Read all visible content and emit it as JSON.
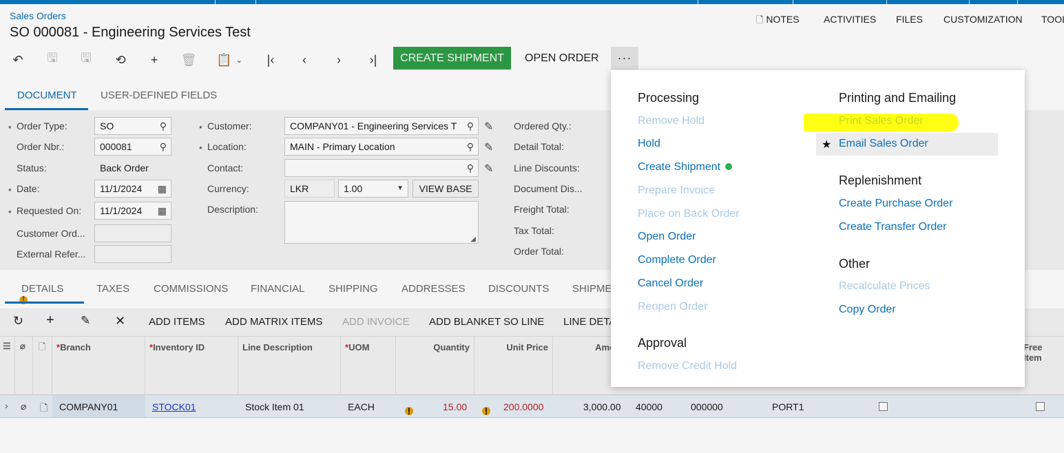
{
  "breadcrumb": "Sales Orders",
  "title": "SO 000081 - Engineering Services Test",
  "top_nav": [
    "NOTES",
    "ACTIVITIES",
    "FILES",
    "CUSTOMIZATION",
    "TOOLS"
  ],
  "toolbar": {
    "create_shipment": "CREATE SHIPMENT",
    "open_order": "OPEN ORDER",
    "more": "···"
  },
  "main_tabs": [
    "DOCUMENT",
    "USER-DEFINED FIELDS"
  ],
  "form": {
    "order_type_label": "Order Type:",
    "order_type": "SO",
    "order_nbr_label": "Order Nbr.:",
    "order_nbr": "000081",
    "status_label": "Status:",
    "status": "Back Order",
    "date_label": "Date:",
    "date": "11/1/2024",
    "requested_on_label": "Requested On:",
    "requested_on": "11/1/2024",
    "customer_ord_label": "Customer Ord...",
    "external_ref_label": "External Refer...",
    "customer_label": "Customer:",
    "customer": "COMPANY01 - Engineering Services T",
    "location_label": "Location:",
    "location": "MAIN - Primary Location",
    "contact_label": "Contact:",
    "currency_label": "Currency:",
    "currency": "LKR",
    "rate": "1.00",
    "view_base": "VIEW BASE",
    "description_label": "Description:",
    "ordered_qty_label": "Ordered Qty.:",
    "detail_total_label": "Detail Total:",
    "line_discounts_label": "Line Discounts:",
    "document_dis_label": "Document Dis...",
    "freight_total_label": "Freight Total:",
    "tax_total_label": "Tax Total:",
    "order_total_label": "Order Total:"
  },
  "detail_tabs": [
    "DETAILS",
    "TAXES",
    "COMMISSIONS",
    "FINANCIAL",
    "SHIPPING",
    "ADDRESSES",
    "DISCOUNTS",
    "SHIPME"
  ],
  "grid_toolbar": {
    "add_items": "ADD ITEMS",
    "add_matrix_items": "ADD MATRIX ITEMS",
    "add_invoice": "ADD INVOICE",
    "add_blanket": "ADD BLANKET SO LINE",
    "line_details": "LINE DETA"
  },
  "grid_headers": {
    "branch": "Branch",
    "inventory_id": "Inventory ID",
    "line_description": "Line Description",
    "uom": "UOM",
    "quantity": "Quantity",
    "unit_price": "Unit Price",
    "amount": "Amo",
    "free_item": "Free Item"
  },
  "grid_row": {
    "branch": "COMPANY01",
    "inventory_id": "STOCK01",
    "line_description": "Stock Item 01",
    "uom": "EACH",
    "quantity": "15.00",
    "unit_price": "200.0000",
    "amount": "3,000.00",
    "c1": "40000",
    "c2": "000000",
    "c3": "PORT1"
  },
  "dropdown": {
    "processing_title": "Processing",
    "processing": [
      {
        "label": "Remove Hold",
        "enabled": false
      },
      {
        "label": "Hold",
        "enabled": true
      },
      {
        "label": "Create Shipment",
        "enabled": true
      },
      {
        "label": "Prepare Invoice",
        "enabled": false
      },
      {
        "label": "Place on Back Order",
        "enabled": false
      },
      {
        "label": "Open Order",
        "enabled": true
      },
      {
        "label": "Complete Order",
        "enabled": true
      },
      {
        "label": "Cancel Order",
        "enabled": true
      },
      {
        "label": "Reopen Order",
        "enabled": false
      }
    ],
    "approval_title": "Approval",
    "approval": [
      {
        "label": "Remove Credit Hold",
        "enabled": false
      }
    ],
    "printing_title": "Printing and Emailing",
    "printing": [
      {
        "label": "Print Sales Order",
        "enabled": true
      },
      {
        "label": "Email Sales Order",
        "enabled": true
      }
    ],
    "replenishment_title": "Replenishment",
    "replenishment": [
      {
        "label": "Create Purchase Order",
        "enabled": true
      },
      {
        "label": "Create Transfer Order",
        "enabled": true
      }
    ],
    "other_title": "Other",
    "other": [
      {
        "label": "Recalculate Prices",
        "enabled": false
      },
      {
        "label": "Copy Order",
        "enabled": true
      }
    ]
  },
  "colors": {
    "accent": "#0a6fb8",
    "primary_button": "#2e9e46",
    "highlight": "#ffff14"
  }
}
